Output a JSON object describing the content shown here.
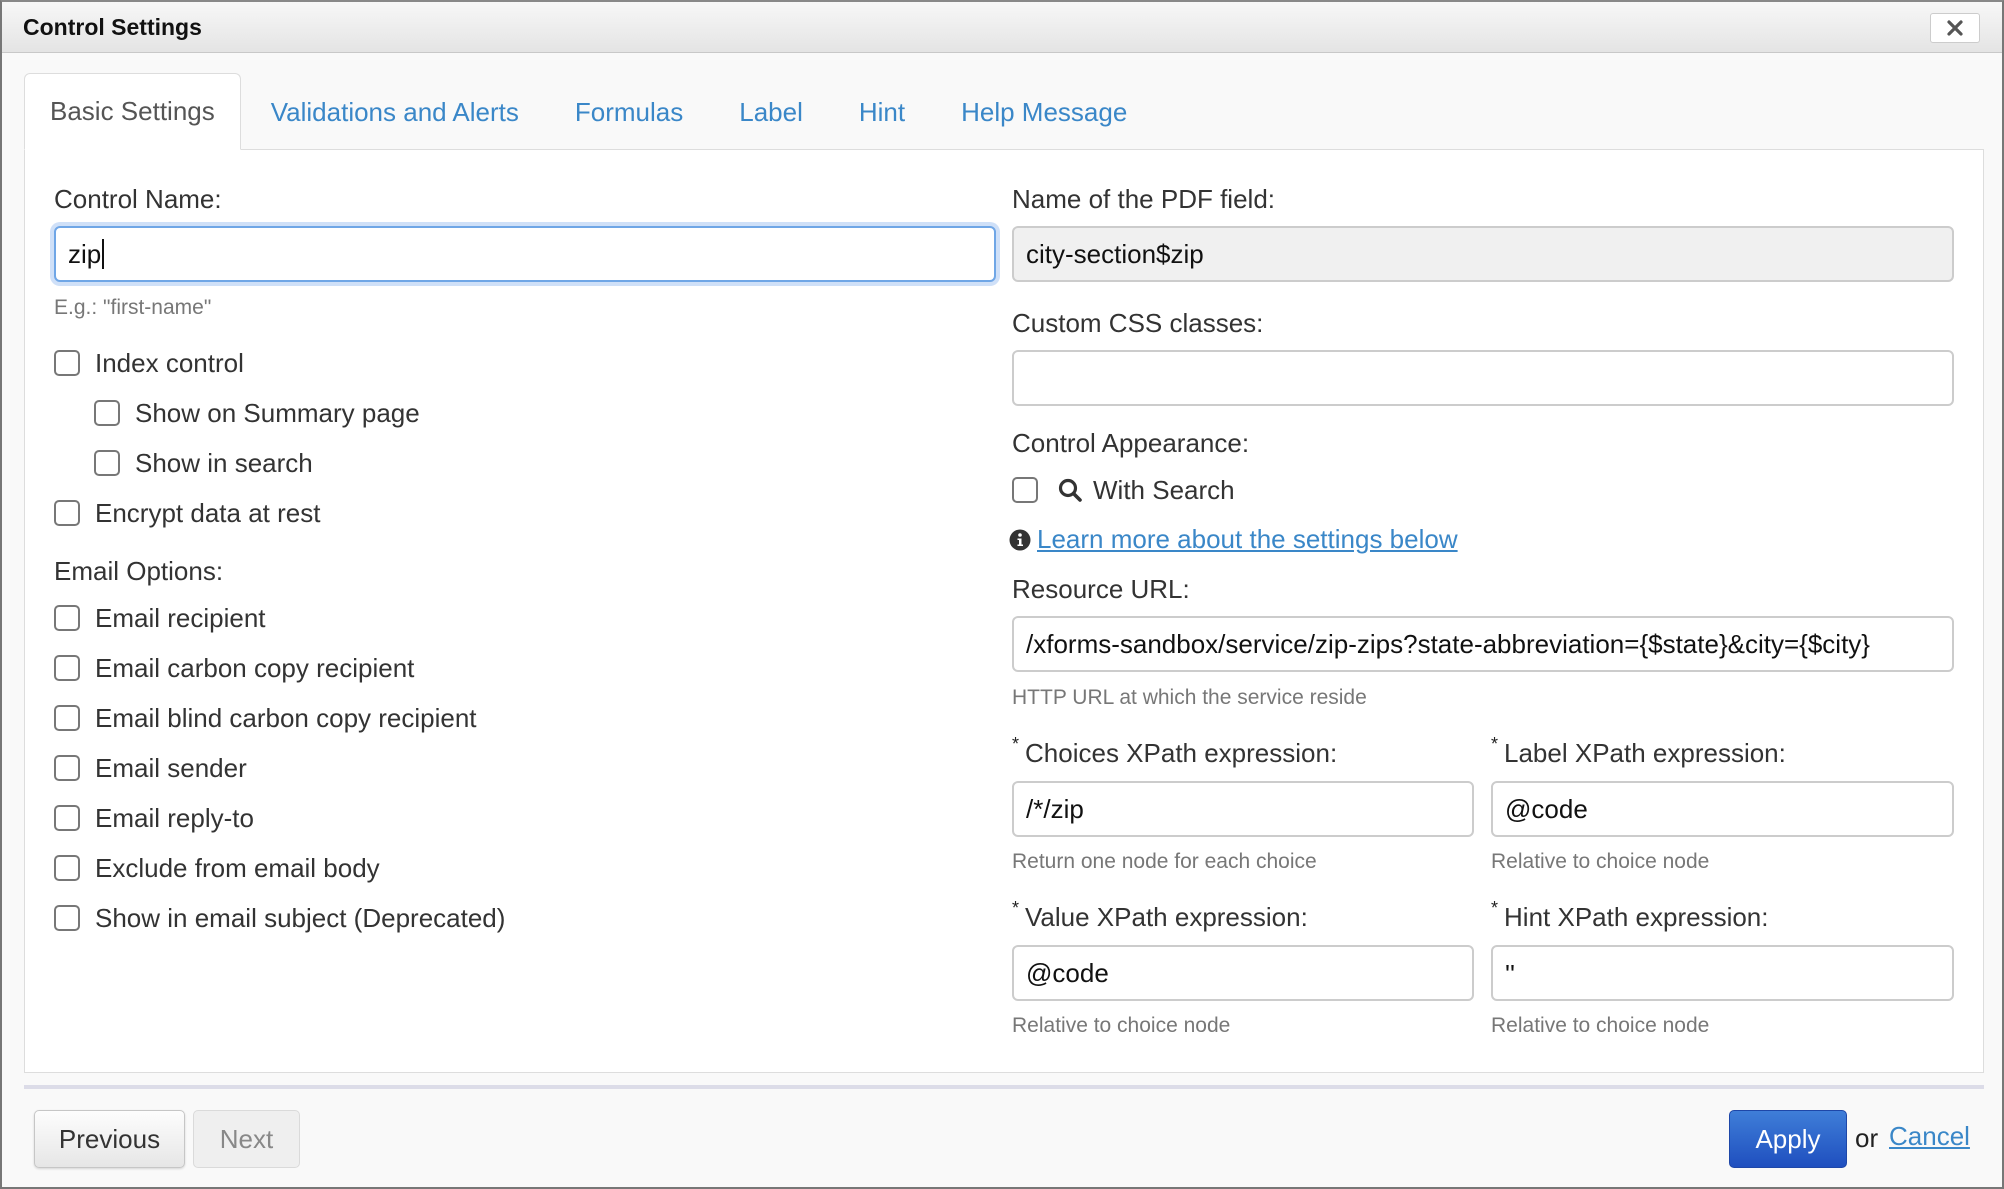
{
  "dialog": {
    "title": "Control Settings",
    "close_icon": "close-icon"
  },
  "tabs": [
    {
      "label": "Basic Settings",
      "active": true
    },
    {
      "label": "Validations and Alerts",
      "active": false
    },
    {
      "label": "Formulas",
      "active": false
    },
    {
      "label": "Label",
      "active": false
    },
    {
      "label": "Hint",
      "active": false
    },
    {
      "label": "Help Message",
      "active": false
    }
  ],
  "left": {
    "control_name": {
      "label": "Control Name:",
      "value": "zip",
      "help": "E.g.: \"first-name\""
    },
    "checkboxes": [
      {
        "label": "Index control",
        "checked": false
      },
      {
        "label": "Show on Summary page",
        "checked": false
      },
      {
        "label": "Show in search",
        "checked": false
      },
      {
        "label": "Encrypt data at rest",
        "checked": false
      }
    ],
    "email_options": {
      "label": "Email Options:",
      "checkboxes": [
        {
          "label": "Email recipient",
          "checked": false
        },
        {
          "label": "Email carbon copy recipient",
          "checked": false
        },
        {
          "label": "Email blind carbon copy recipient",
          "checked": false
        },
        {
          "label": "Email sender",
          "checked": false
        },
        {
          "label": "Email reply-to",
          "checked": false
        },
        {
          "label": "Exclude from email body",
          "checked": false
        },
        {
          "label": "Show in email subject (Deprecated)",
          "checked": false
        }
      ]
    }
  },
  "right": {
    "pdf_field": {
      "label": "Name of the PDF field:",
      "value": "city-section$zip"
    },
    "css_classes": {
      "label": "Custom CSS classes:",
      "value": ""
    },
    "appearance": {
      "label": "Control Appearance:",
      "with_search": {
        "label": "With Search",
        "checked": false,
        "icon": "search-icon"
      }
    },
    "learn_more": {
      "icon": "info-icon",
      "text": "Learn more about the settings below"
    },
    "resource_url": {
      "label": "Resource URL:",
      "value": "/xforms-sandbox/service/zip-zips?state-abbreviation={$state}&city={$city}",
      "help": "HTTP URL at which the service reside"
    },
    "choices_xpath": {
      "required_mark": "*",
      "label": "Choices XPath expression:",
      "value": "/*/zip",
      "help": "Return one node for each choice"
    },
    "label_xpath": {
      "required_mark": "*",
      "label": "Label XPath expression:",
      "value": "@code",
      "help": "Relative to choice node"
    },
    "value_xpath": {
      "required_mark": "*",
      "label": "Value XPath expression:",
      "value": "@code",
      "help": "Relative to choice node"
    },
    "hint_xpath": {
      "required_mark": "*",
      "label": "Hint XPath expression:",
      "value": "''",
      "help": "Relative to choice node"
    }
  },
  "footer": {
    "previous_label": "Previous",
    "next_label": "Next",
    "apply_label": "Apply",
    "or_text": "or",
    "cancel_label": "Cancel"
  },
  "colors": {
    "link": "#3a87c8",
    "apply_button": "#2a5fcb",
    "focus_ring": "#cfe0f8"
  }
}
